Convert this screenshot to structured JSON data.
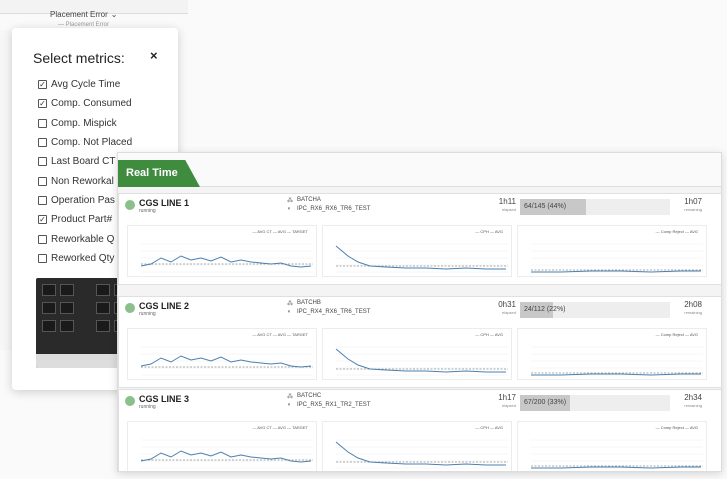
{
  "background": {
    "placement_error_label": "Placement Error",
    "placement_error_sub": "— Placement Error"
  },
  "metrics_dialog": {
    "title": "Select metrics:",
    "close_symbol": "×",
    "items": [
      {
        "label": "Avg Cycle Time",
        "checked": true
      },
      {
        "label": "Comp. Consumed",
        "checked": true
      },
      {
        "label": "Comp. Mispick",
        "checked": false
      },
      {
        "label": "Comp. Not Placed",
        "checked": false
      },
      {
        "label": "Last Board CT",
        "checked": false
      },
      {
        "label": "Non Reworkal",
        "checked": false
      },
      {
        "label": "Operation Pas",
        "checked": false
      },
      {
        "label": "Product Part#",
        "checked": true
      },
      {
        "label": "Reworkable Q",
        "checked": false
      },
      {
        "label": "Reworked Qty",
        "checked": false
      }
    ]
  },
  "real_time": {
    "tab_label": "Real Time",
    "elapsed_label": "elapsed",
    "remaining_label": "remaining",
    "legends": {
      "cycle": "— AVG CT  — AVG  — TARGET",
      "cph": "— CPH  — AVG",
      "reject": "— Comp Reject  — AVG"
    },
    "lines": [
      {
        "name": "CGS LINE 1",
        "status": "running",
        "batch": "BATCHA",
        "recipe": "IPC_RX6_RX6_TR6_TEST",
        "elapsed": "1h11",
        "progress_text": "64/145 (44%)",
        "progress": 0.44,
        "remaining": "1h07"
      },
      {
        "name": "CGS LINE 2",
        "status": "running",
        "batch": "BATCHB",
        "recipe": "IPC_RX4_RX6_TR6_TEST",
        "elapsed": "0h31",
        "progress_text": "24/112 (22%)",
        "progress": 0.22,
        "remaining": "2h08"
      },
      {
        "name": "CGS LINE 3",
        "status": "running",
        "batch": "BATCHC",
        "recipe": "IPC_RX5_RX1_TR2_TEST",
        "elapsed": "1h17",
        "progress_text": "67/200 (33%)",
        "progress": 0.33,
        "remaining": "2h34"
      }
    ]
  },
  "colors": {
    "tab_green": "#3f8c3f",
    "status_green": "#8bc08b",
    "line_blue": "#4a7fb0"
  }
}
